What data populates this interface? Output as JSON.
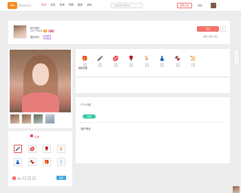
{
  "logo": {
    "text": "ZBJ",
    "sub": "相亲交友平台"
  },
  "nav": {
    "items": [
      "首页",
      "交友",
      "在线",
      "同城",
      "相亲",
      "活动"
    ]
  },
  "search": {
    "placeholder": "搜索用户昵称/ID"
  },
  "top": {
    "upload": "我的主页",
    "msg": "消息",
    "caret": "▾"
  },
  "profile": {
    "nickname_label": "用户昵称：",
    "id_line": "173****5978",
    "badge_v": "V",
    "badge_o": "会员",
    "tag_label": "婚恋状态：",
    "tag": "未婚",
    "follow": "关注",
    "follow_x": "✕",
    "report": "举报 | 拉黑 | 送礼"
  },
  "gift_panel": {
    "title": "礼物",
    "qty_label": "送给",
    "qty_value": "1",
    "send": "赠送",
    "gifts": [
      {
        "icon": "🎤",
        "selected": true
      },
      {
        "icon": "💋",
        "selected": false
      },
      {
        "icon": "🌹",
        "selected": false
      },
      {
        "icon": "🍹",
        "selected": false
      },
      {
        "icon": "👗",
        "selected": false
      },
      {
        "icon": "🍫",
        "selected": false
      },
      {
        "icon": "🎁",
        "selected": false
      },
      {
        "icon": "💍",
        "selected": false
      }
    ]
  },
  "received": {
    "label": "她的礼物",
    "gifts": [
      {
        "icon": "🎁",
        "count": "0"
      },
      {
        "icon": "🎤",
        "count": "0"
      },
      {
        "icon": "💋",
        "count": "0"
      },
      {
        "icon": "🌹",
        "count": "0"
      },
      {
        "icon": "🍹",
        "count": "0"
      },
      {
        "icon": "👗",
        "count": "0"
      },
      {
        "icon": "🍫",
        "count": "0"
      },
      {
        "icon": "📜",
        "count": "0"
      }
    ]
  },
  "info": {
    "intro_title": "个人介绍",
    "intro_tag": "未填",
    "account_title": "账户安全"
  }
}
